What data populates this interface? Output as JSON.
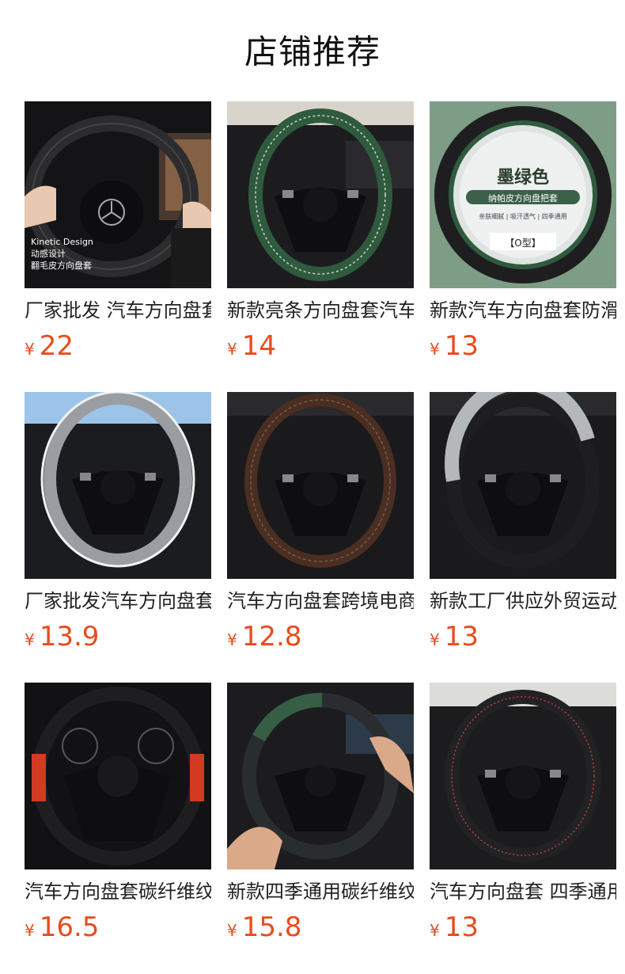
{
  "title": "店铺推荐",
  "currency": "¥",
  "colors": {
    "price": "#e84c1c",
    "title": "#111111"
  },
  "products": [
    {
      "name": "厂家批发 汽车方向盘套",
      "price": "22",
      "image_text": [
        "Kinetic Design",
        "动感设计",
        "翻毛皮方向盘套"
      ],
      "grip_color": "#2c2c2e",
      "bg": "#141416"
    },
    {
      "name": "新款亮条方向盘套汽车",
      "price": "14",
      "image_text": [],
      "grip_color": "#2f5a3e",
      "bg": "#1c1c1e"
    },
    {
      "name": "新款汽车方向盘套防滑",
      "price": "13",
      "image_text": [
        "墨绿色",
        "纳帕皮方向盘把套",
        "亲肤细腻 | 吸汗透气 | 四季通用",
        "【O型】"
      ],
      "grip_color": "#2f5a3e",
      "bg": "#7e9d86"
    },
    {
      "name": "厂家批发汽车方向盘套",
      "price": "13.9",
      "image_text": [],
      "grip_color": "#9a9ea2",
      "bg": "#1a1c20"
    },
    {
      "name": "汽车方向盘套跨境电商",
      "price": "12.8",
      "image_text": [],
      "grip_color": "#4a2e22",
      "bg": "#1a1a1c"
    },
    {
      "name": "新款工厂供应外贸运动",
      "price": "13",
      "image_text": [],
      "grip_color": "#b4b8bb",
      "bg": "#1a1a1c"
    },
    {
      "name": "汽车方向盘套碳纤维纹",
      "price": "16.5",
      "image_text": [],
      "grip_color": "#d23a22",
      "bg": "#121214"
    },
    {
      "name": "新款四季通用碳纤维纹",
      "price": "15.8",
      "image_text": [],
      "grip_color": "#355e44",
      "bg": "#1c1c1e"
    },
    {
      "name": "汽车方向盘套 四季通用",
      "price": "13",
      "image_text": [],
      "grip_color": "#222224",
      "bg": "#1c1c1e"
    }
  ]
}
